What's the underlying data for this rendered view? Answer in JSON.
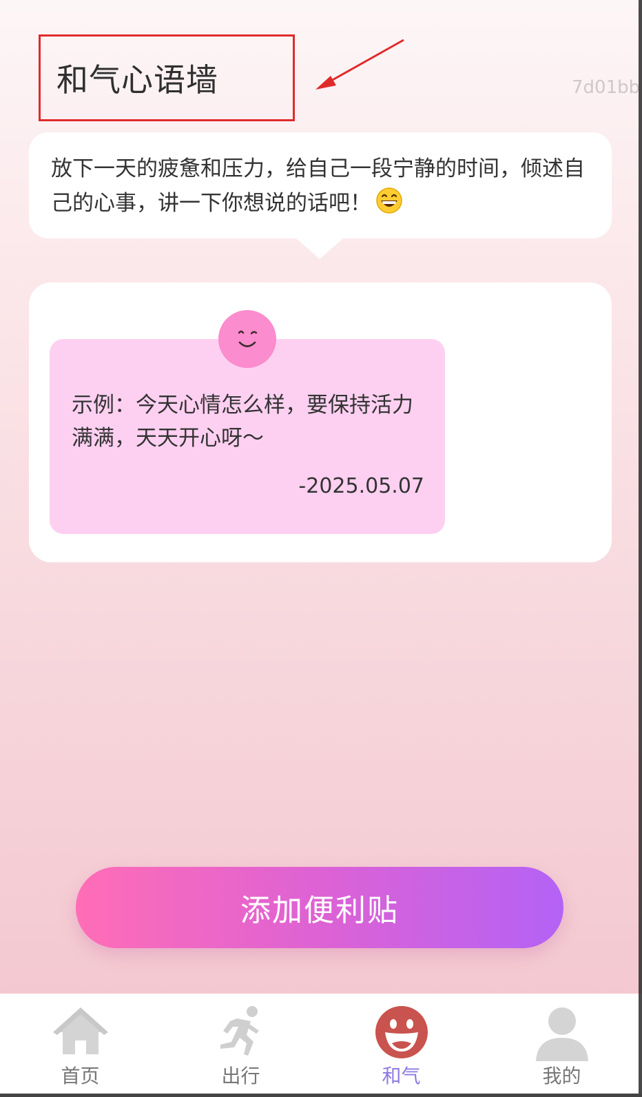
{
  "header": {
    "title": "和气心语墙",
    "user_code": "7d01bb"
  },
  "intro": {
    "text": "放下一天的疲惫和压力，给自己一段宁静的时间，倾述自己的心事，讲一下你想说的话吧！",
    "emoji": "grinning-face-emoji"
  },
  "notes": [
    {
      "text": "示例：今天心情怎么样，要保持活力满满，天天开心呀～",
      "date": "-2025.05.07",
      "color": "#fdd0f1",
      "avatar_icon": "smile-face-icon"
    }
  ],
  "actions": {
    "add_note_label": "添加便利贴"
  },
  "tabbar": {
    "active_index": 2,
    "active_color": "#8e7ae0",
    "items": [
      {
        "label": "首页",
        "icon": "home-icon"
      },
      {
        "label": "出行",
        "icon": "running-person-icon"
      },
      {
        "label": "和气",
        "icon": "laughing-face-icon"
      },
      {
        "label": "我的",
        "icon": "user-icon"
      }
    ]
  },
  "colors": {
    "button_gradient_start": "#ff6db6",
    "button_gradient_end": "#b462f6",
    "annotation_red": "#e02a2a"
  }
}
